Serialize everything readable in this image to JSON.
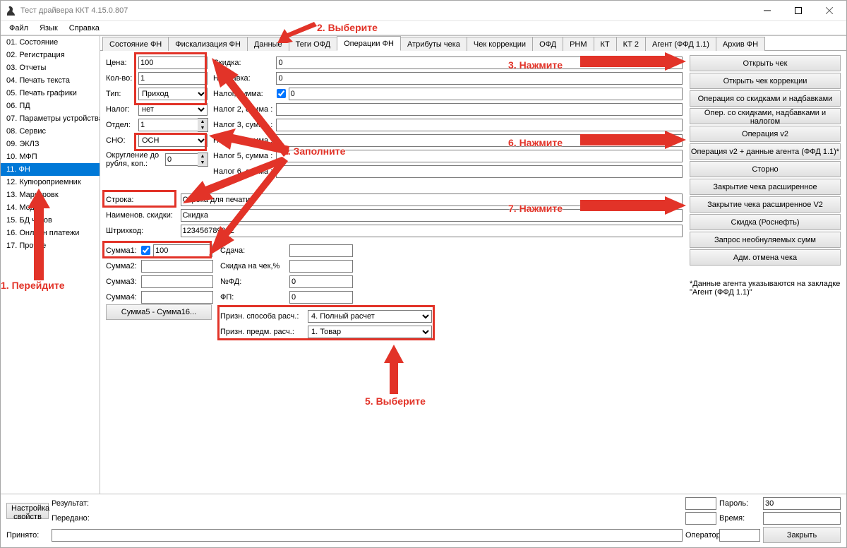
{
  "window": {
    "title": "Тест драйвера ККТ 4.15.0.807"
  },
  "menu": [
    "Файл",
    "Язык",
    "Справка"
  ],
  "sidebar": {
    "items": [
      "01. Состояние",
      "02. Регистрация",
      "03. Отчеты",
      "04. Печать текста",
      "05. Печать графики",
      "06. ПД",
      "07. Параметры устройства",
      "08. Сервис",
      "09. ЭКЛЗ",
      "10. МФП",
      "11. ФН",
      "12. Купюроприемник",
      "13. Маркировк",
      "14. Модем",
      "15. БД чеков",
      "16. Онлайн платежи",
      "17. Прочее"
    ],
    "selected": 10
  },
  "tabs": [
    "Состояние ФН",
    "Фискализация ФН",
    "Данные",
    "Теги ОФД",
    "Операции ФН",
    "Атрибуты чека",
    "Чек коррекции",
    "ОФД",
    "РНМ",
    "КТ",
    "КТ 2",
    "Агент (ФФД 1.1)",
    "Архив ФН"
  ],
  "tabActive": 4,
  "left": {
    "price_lbl": "Цена:",
    "price": "100",
    "qty_lbl": "Кол-во:",
    "qty": "1",
    "type_lbl": "Тип:",
    "type": "Приход",
    "tax_lbl": "Налог:",
    "tax": "нет",
    "dept_lbl": "Отдел:",
    "dept": "1",
    "sno_lbl": "СНО:",
    "sno": "ОСН",
    "round_lbl1": "Округление до",
    "round_lbl2": "рубля, коп.:",
    "round": "0"
  },
  "mid": {
    "disc_lbl": "Скидка:",
    "disc": "0",
    "surch_lbl": "Надбавка:",
    "surch": "0",
    "taxsum_lbl": "Налог, сумма:",
    "taxsum": "0",
    "tax2_lbl": "Налог 2, сумма :",
    "tax2": "",
    "tax3_lbl": "Налог 3, сумма :",
    "tax3": "",
    "tax4_lbl": "Налог 4, сумма :",
    "tax4": "",
    "tax5_lbl": "Налог 5, сумма :",
    "tax5": "",
    "tax6_lbl": "Налог 6, сумма :",
    "tax6": ""
  },
  "str": {
    "stroka_lbl": "Строка:",
    "stroka": "Строка для печати",
    "namedisc_lbl": "Наименов. скидки:",
    "namedisc": "Скидка",
    "barcode_lbl": "Штрихкод:",
    "barcode": "123456789012"
  },
  "sums": {
    "s1_lbl": "Сумма1:",
    "s1": "100",
    "s2_lbl": "Сумма2:",
    "s2": "",
    "s3_lbl": "Сумма3:",
    "s3": "",
    "s4_lbl": "Сумма4:",
    "s4": "",
    "more_btn": "Сумма5 - Сумма16...",
    "change_lbl": "Сдача:",
    "change": "",
    "discchk_lbl": "Скидка на чек,%",
    "discchk": "",
    "fdnum_lbl": "№ФД:",
    "fdnum": "0",
    "fp_lbl": "ФП:",
    "fp": "0",
    "pay_lbl": "Призн. способа расч.:",
    "pay": "4. Полный расчет",
    "subj_lbl": "Призн. предм. расч.:",
    "subj": "1. Товар"
  },
  "buttons": [
    "Открыть чек",
    "Открыть чек коррекции",
    "Операция со скидками и надбавками",
    "Опер. со скидками, надбавками и налогом",
    "Операция v2",
    "Операция v2 + данные агента (ФФД 1.1)*",
    "Сторно",
    "Закрытие чека расширенное",
    "Закрытие чека расширенное V2",
    "Скидка (Роснефть)",
    "Запрос необнуляемых сумм",
    "Адм. отмена чека"
  ],
  "note": "*Данные агента указываются на закладке \"Агент (ФФД 1.1)\"",
  "status": {
    "result_lbl": "Результат:",
    "result": "",
    "sent_lbl": "Передано:",
    "sent": "",
    "recv_lbl": "Принято:",
    "recv": "",
    "pass_lbl": "Пароль:",
    "pass": "30",
    "time_lbl": "Время:",
    "time": "",
    "oper_lbl": "Оператор:",
    "oper": "",
    "settings_btn": "Настройка свойств",
    "close_btn": "Закрыть"
  },
  "anno": {
    "a1": "1. Перейдите",
    "a2": "2. Выберите",
    "a3": "3. Нажмите",
    "a4": "4. Заполните",
    "a5": "5. Выберите",
    "a6": "6. Нажмите",
    "a7": "7. Нажмите"
  }
}
